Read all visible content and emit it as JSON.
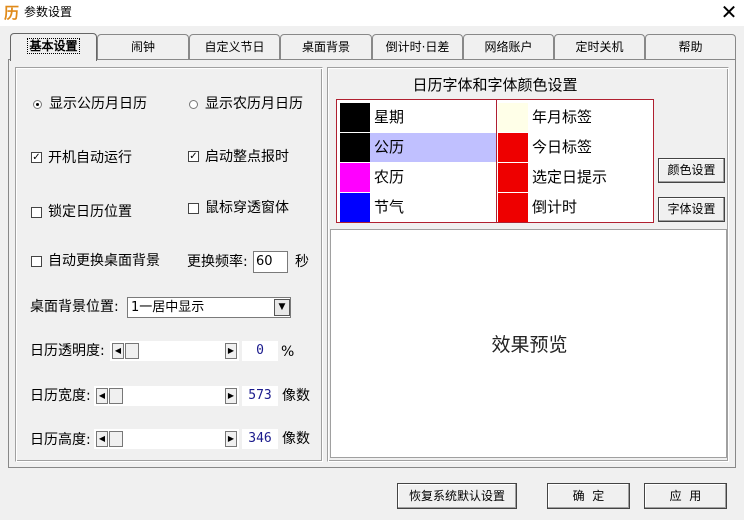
{
  "window": {
    "title": "参数设置",
    "app_icon": "历",
    "close": "✕"
  },
  "tabs": [
    {
      "label": "基本设置",
      "active": true
    },
    {
      "label": "闹钟"
    },
    {
      "label": "自定义节日"
    },
    {
      "label": "桌面背景"
    },
    {
      "label": "倒计时·日差"
    },
    {
      "label": "网络账户"
    },
    {
      "label": "定时关机"
    },
    {
      "label": "帮助"
    }
  ],
  "basic": {
    "radio_solar": {
      "label": "显示公历月日历",
      "checked": true
    },
    "radio_lunar": {
      "label": "显示农历月日历",
      "checked": false
    },
    "autostart": {
      "label": "开机自动运行",
      "checked": true
    },
    "hourly_chime": {
      "label": "启动整点报时",
      "checked": true
    },
    "lock_position": {
      "label": "锁定日历位置",
      "checked": false
    },
    "mouse_through": {
      "label": "鼠标穿透窗体",
      "checked": false
    },
    "auto_wallpaper": {
      "label": "自动更换桌面背景",
      "checked": false
    },
    "freq_label": "更换频率:",
    "freq_value": "60",
    "freq_unit": "秒",
    "bg_position_label": "桌面背景位置:",
    "bg_position_value": "1一居中显示",
    "transparency_label": "日历透明度:",
    "transparency_value": "0",
    "transparency_unit": "%",
    "width_label": "日历宽度:",
    "width_value": "573",
    "width_unit": "像数",
    "height_label": "日历高度:",
    "height_value": "346",
    "height_unit": "像数"
  },
  "font_colors": {
    "title": "日历字体和字体颜色设置",
    "rows": [
      {
        "left_label": "星期",
        "left_color": "#000000",
        "right_label": "年月标签",
        "right_color": "#ffffe8"
      },
      {
        "left_label": "公历",
        "left_color": "#000000",
        "right_label": "今日标签",
        "right_color": "#ee0000",
        "left_selected": true
      },
      {
        "left_label": "农历",
        "left_color": "#ff00ff",
        "right_label": "选定日提示",
        "right_color": "#ee0000"
      },
      {
        "left_label": "节气",
        "left_color": "#0000ff",
        "right_label": "倒计时",
        "right_color": "#ee0000"
      }
    ],
    "color_button": "颜色设置",
    "font_button": "字体设置",
    "preview_text": "效果预览"
  },
  "footer": {
    "reset": "恢复系统默认设置",
    "ok": "确  定",
    "apply": "应  用"
  },
  "icons": {
    "app": "calendar-app-icon",
    "close": "close-icon",
    "scroll_left": "arrow-left-icon",
    "scroll_right": "arrow-right-icon",
    "dropdown": "chevron-down-icon"
  },
  "colors": {
    "selected_row": "#c0c0ff",
    "grid_border": "#b02030",
    "value_text": "#1a1a8c"
  }
}
